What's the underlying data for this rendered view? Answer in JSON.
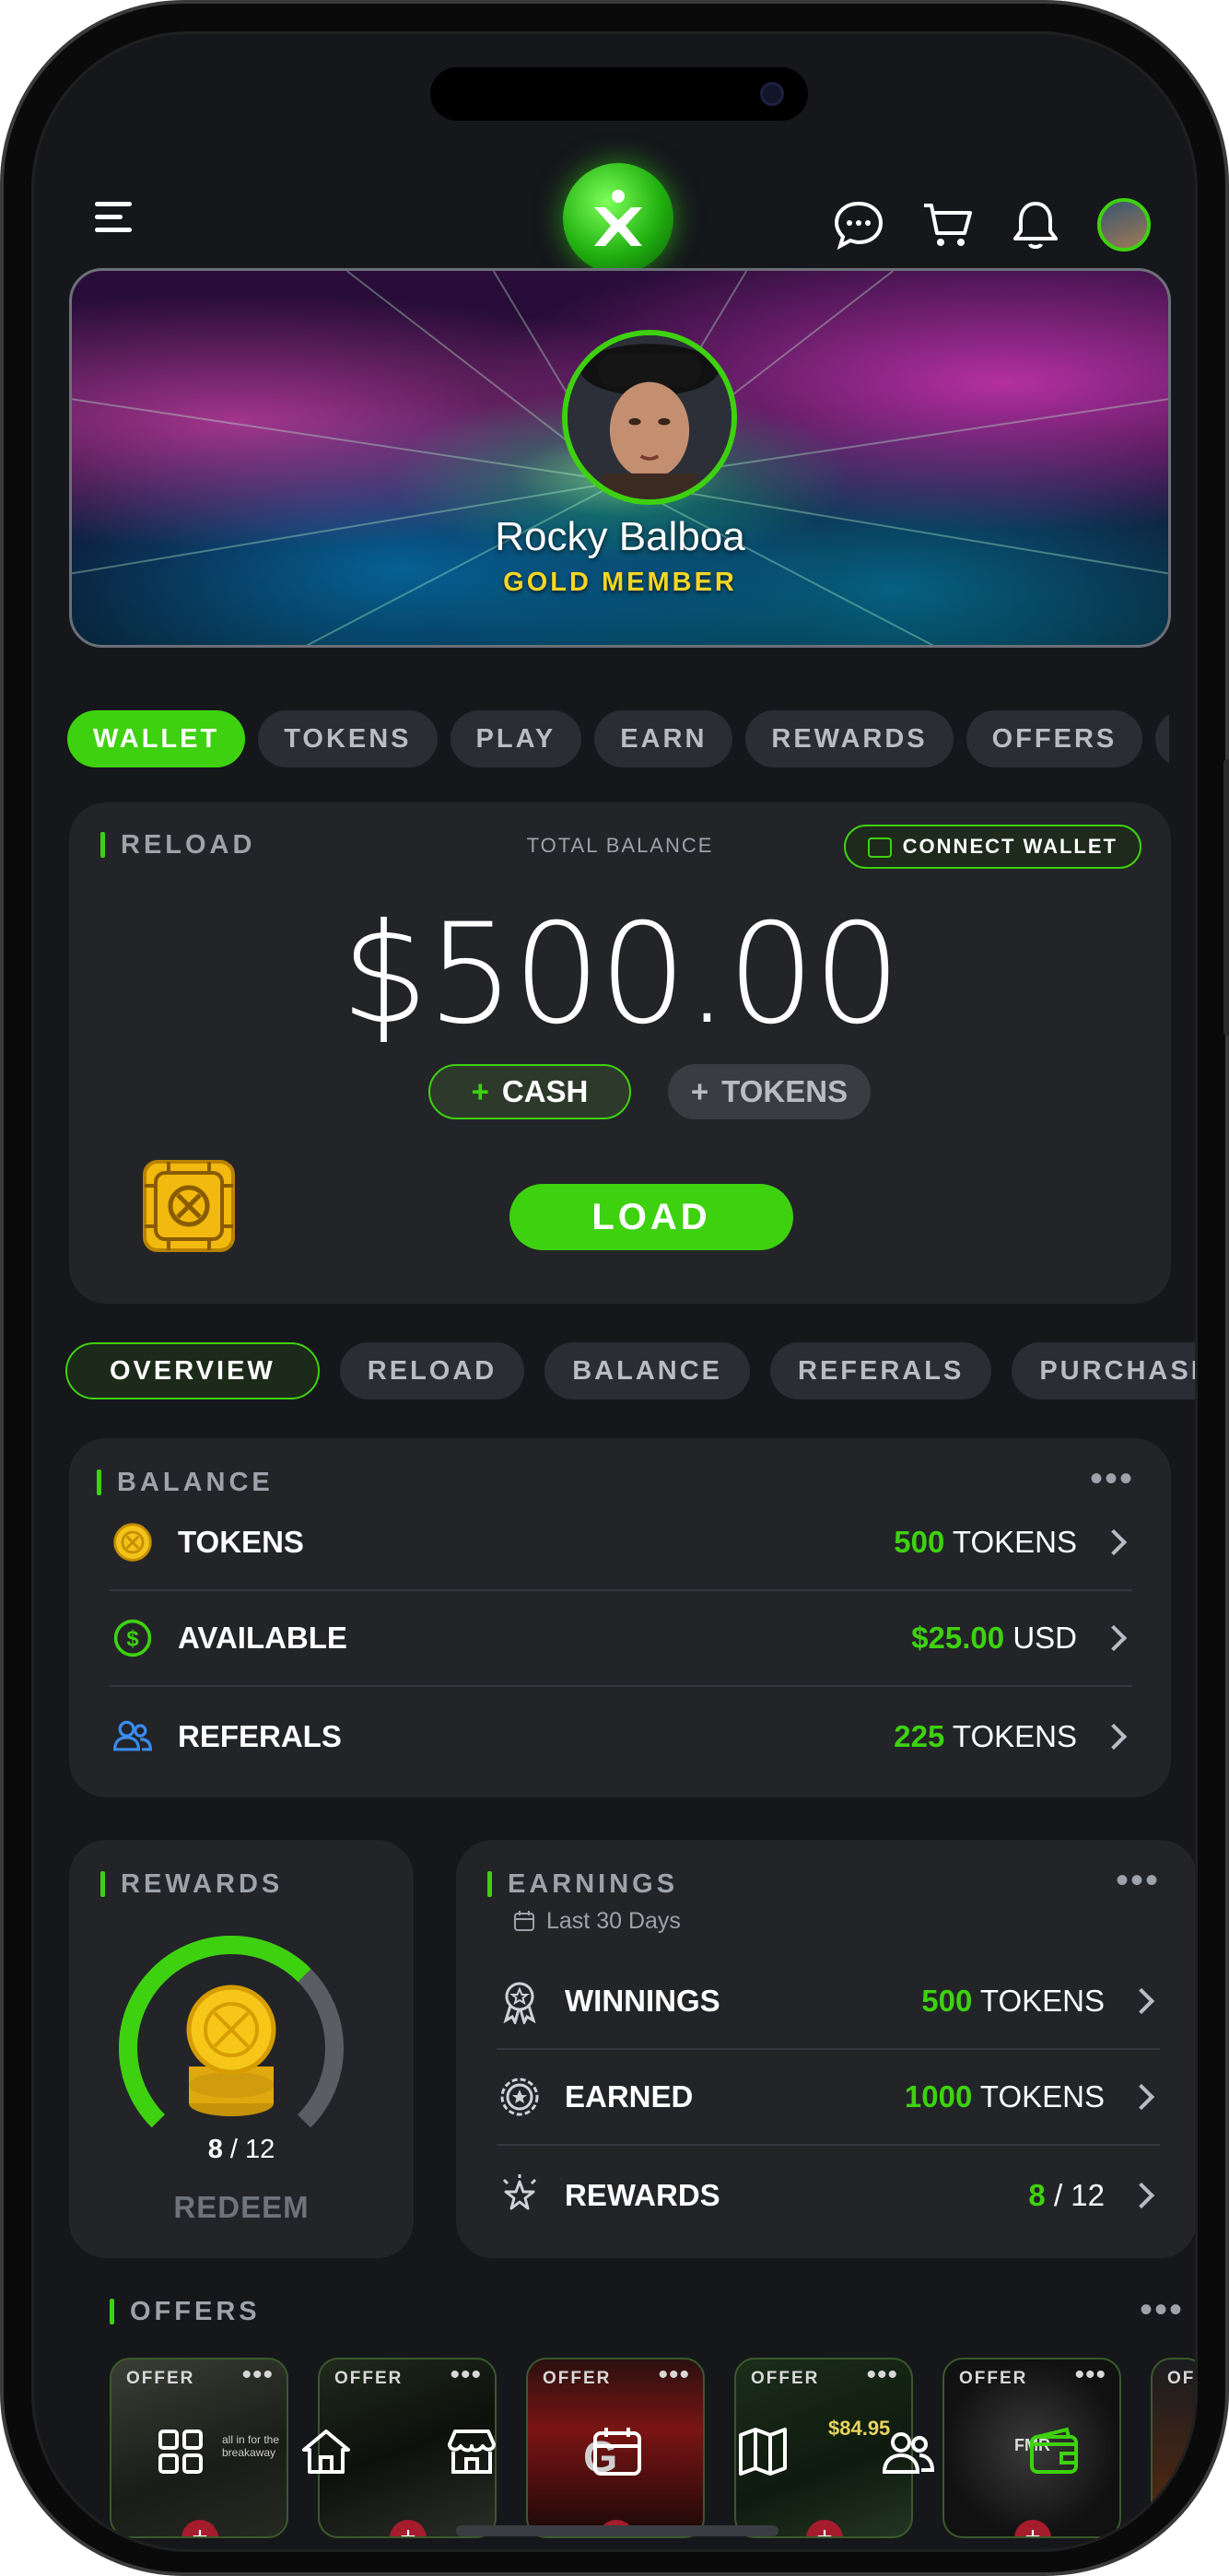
{
  "header": {
    "icons": [
      "menu-icon",
      "chat-icon",
      "cart-icon",
      "bell-icon",
      "avatar"
    ]
  },
  "profile": {
    "name": "Rocky Balboa",
    "tier": "GOLD MEMBER"
  },
  "tabs": [
    {
      "label": "WALLET",
      "active": true
    },
    {
      "label": "TOKENS"
    },
    {
      "label": "PLAY"
    },
    {
      "label": "EARN"
    },
    {
      "label": "REWARDS"
    },
    {
      "label": "OFFERS"
    },
    {
      "label": "F"
    }
  ],
  "reload": {
    "title": "RELOAD",
    "total_label": "TOTAL BALANCE",
    "connect_label": "CONNECT WALLET",
    "amount": "$500.00",
    "cash_label": "CASH",
    "tokens_label": "TOKENS",
    "plus": "+",
    "load_label": "LOAD"
  },
  "subtabs": [
    {
      "label": "OVERVIEW",
      "active": true
    },
    {
      "label": "RELOAD"
    },
    {
      "label": "BALANCE"
    },
    {
      "label": "REFERALS"
    },
    {
      "label": "PURCHASES"
    }
  ],
  "balance": {
    "title": "BALANCE",
    "dots": "•••",
    "rows": [
      {
        "label": "TOKENS",
        "value": "500",
        "unit": "TOKENS",
        "icon": "token-coin-icon"
      },
      {
        "label": "AVAILABLE",
        "value": "$25.00",
        "unit": "USD",
        "icon": "dollar-circle-icon"
      },
      {
        "label": "REFERALS",
        "value": "225",
        "unit": "TOKENS",
        "icon": "users-icon"
      }
    ]
  },
  "rewards": {
    "title": "REWARDS",
    "current": "8",
    "sep": "/",
    "total": "12",
    "progress": 0.667,
    "redeem_label": "REDEEM"
  },
  "earnings": {
    "title": "EARNINGS",
    "period": "Last 30 Days",
    "dots": "•••",
    "rows": [
      {
        "label": "WINNINGS",
        "value": "500",
        "unit": "TOKENS",
        "icon": "award-ribbon-icon"
      },
      {
        "label": "EARNED",
        "value": "1000",
        "unit": "TOKENS",
        "icon": "star-badge-icon"
      },
      {
        "label": "REWARDS",
        "value": "8",
        "unit": "/ 12",
        "icon": "sparkle-star-icon"
      }
    ]
  },
  "offers": {
    "title": "OFFERS",
    "dots": "•••",
    "items": [
      {
        "label": "OFFER",
        "dots": "•••",
        "text": "all in for the breakaway"
      },
      {
        "label": "OFFER",
        "dots": "•••"
      },
      {
        "label": "OFFER",
        "dots": "•••",
        "text": "G"
      },
      {
        "label": "OFFER",
        "dots": "•••",
        "text": "$84.95"
      },
      {
        "label": "OFFER",
        "dots": "•••",
        "text": "FMR"
      },
      {
        "label": "OFF",
        "dots": ""
      }
    ],
    "plus": "+"
  },
  "nav": {
    "items": [
      "dashboard-icon",
      "home-icon",
      "store-icon",
      "calendar-icon",
      "map-icon",
      "people-icon",
      "wallet-icon"
    ],
    "active": "wallet-icon"
  },
  "colors": {
    "accent": "#3ed10f",
    "gold": "#f4d624",
    "bg": "#15171b",
    "card": "#222428"
  }
}
